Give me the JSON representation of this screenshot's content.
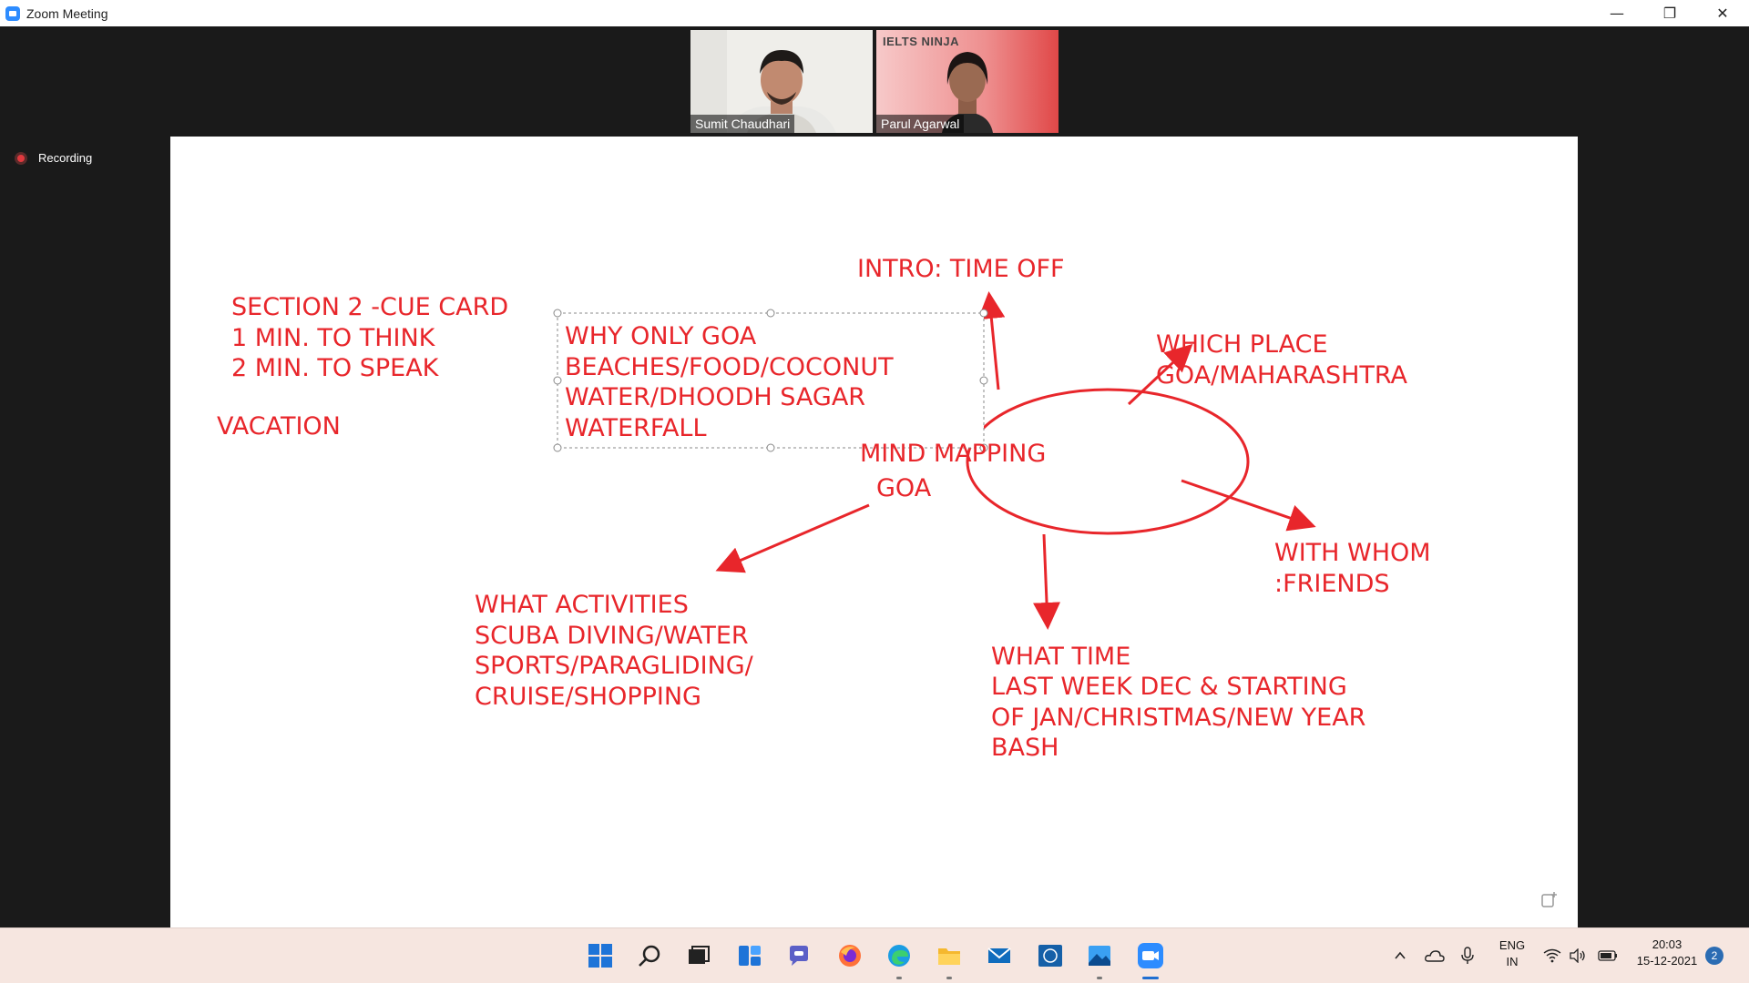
{
  "window": {
    "title": "Zoom Meeting",
    "minimize_label": "—",
    "restore_label": "❐",
    "close_label": "✕"
  },
  "participants": [
    {
      "name": "Sumit Chaudhari"
    },
    {
      "name": "Parul Agarwal",
      "brand": "IELTS NINJA"
    }
  ],
  "recording": {
    "label": "Recording"
  },
  "whiteboard": {
    "color": "#e8262b",
    "cue_card": [
      "SECTION 2 -CUE CARD",
      "1 MIN. TO THINK",
      "2 MIN. TO SPEAK"
    ],
    "topic": "VACATION",
    "why_only_goa": [
      "WHY ONLY GOA",
      "BEACHES/FOOD/COCONUT",
      "WATER/DHOODH SAGAR",
      "WATERFALL"
    ],
    "center": [
      "MIND MAPPING",
      "GOA"
    ],
    "intro": "INTRO:  TIME OFF",
    "which_place": [
      "WHICH PLACE",
      "GOA/MAHARASHTRA"
    ],
    "with_whom": [
      "WITH WHOM",
      ":FRIENDS"
    ],
    "what_time": [
      "WHAT TIME",
      "LAST WEEK DEC & STARTING",
      "OF JAN/CHRISTMAS/NEW YEAR",
      "BASH"
    ],
    "what_activities": [
      "WHAT ACTIVITIES",
      "SCUBA DIVING/WATER",
      "SPORTS/PARAGLIDING/",
      "CRUISE/SHOPPING"
    ]
  },
  "taskbar": {
    "icons": [
      "start-icon",
      "search-icon",
      "task-view-icon",
      "widgets-icon",
      "teams-chat-icon",
      "firefox-icon",
      "edge-icon",
      "file-explorer-icon",
      "mail-icon",
      "dell-icon",
      "photos-icon",
      "zoom-icon"
    ],
    "language": "ENG",
    "region": "IN",
    "time": "20:03",
    "date": "15-12-2021",
    "notifications": "2"
  }
}
